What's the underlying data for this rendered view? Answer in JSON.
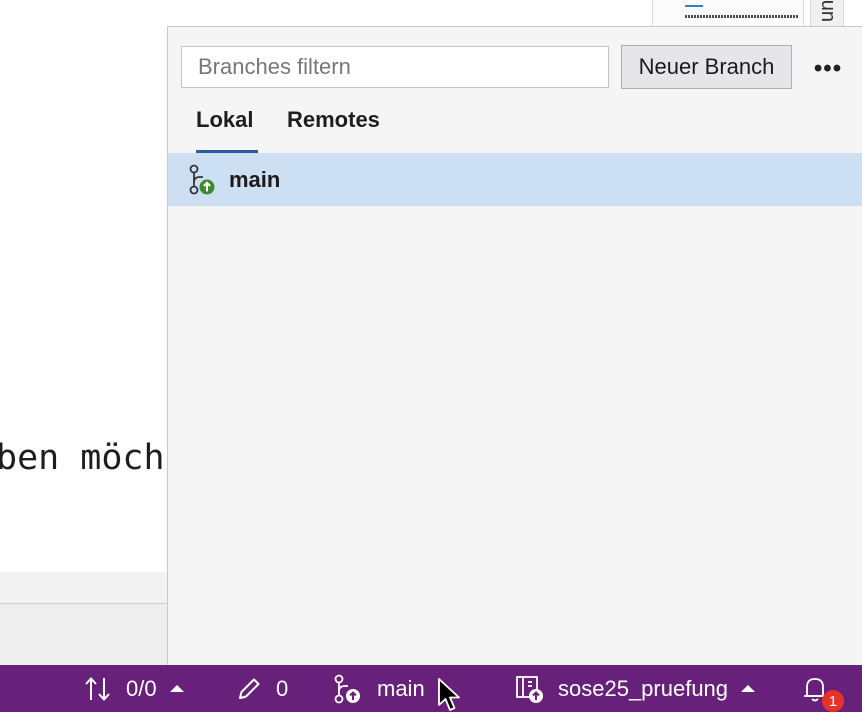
{
  "editor": {
    "visible_text": "ben möch",
    "side_tab_label": "un"
  },
  "branch_flyout": {
    "filter_placeholder": "Branches filtern",
    "new_branch_label": "Neuer Branch",
    "more_label": "•••",
    "tabs": [
      {
        "label": "Lokal",
        "selected": true
      },
      {
        "label": "Remotes",
        "selected": false
      }
    ],
    "branches": [
      {
        "name": "main",
        "selected": true,
        "icon": "branch-publish-icon"
      }
    ]
  },
  "status_bar": {
    "sync_text": "0/0",
    "changes_count": "0",
    "branch_name": "main",
    "repo_name": "sose25_pruefung",
    "notification_count": "1"
  },
  "colors": {
    "status_bar_bg": "#68217a",
    "selected_row_bg": "#cddff3",
    "tab_underline": "#2b5b9a",
    "badge": "#e5332a"
  }
}
